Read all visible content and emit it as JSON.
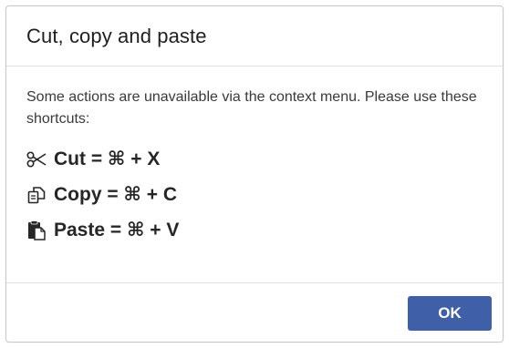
{
  "dialog": {
    "title": "Cut, copy and paste",
    "message": "Some actions are unavailable via the context menu. Please use these shortcuts:",
    "shortcuts": [
      {
        "icon": "scissors-icon",
        "label": "Cut = ⌘ + X"
      },
      {
        "icon": "copy-icon",
        "label": "Copy = ⌘ + C"
      },
      {
        "icon": "paste-icon",
        "label": "Paste = ⌘ + V"
      }
    ],
    "ok_label": "OK"
  },
  "colors": {
    "button_bg": "#3f5fa8",
    "button_text": "#ffffff",
    "border": "#c9c9c9",
    "title_text": "#1f1f1f"
  }
}
